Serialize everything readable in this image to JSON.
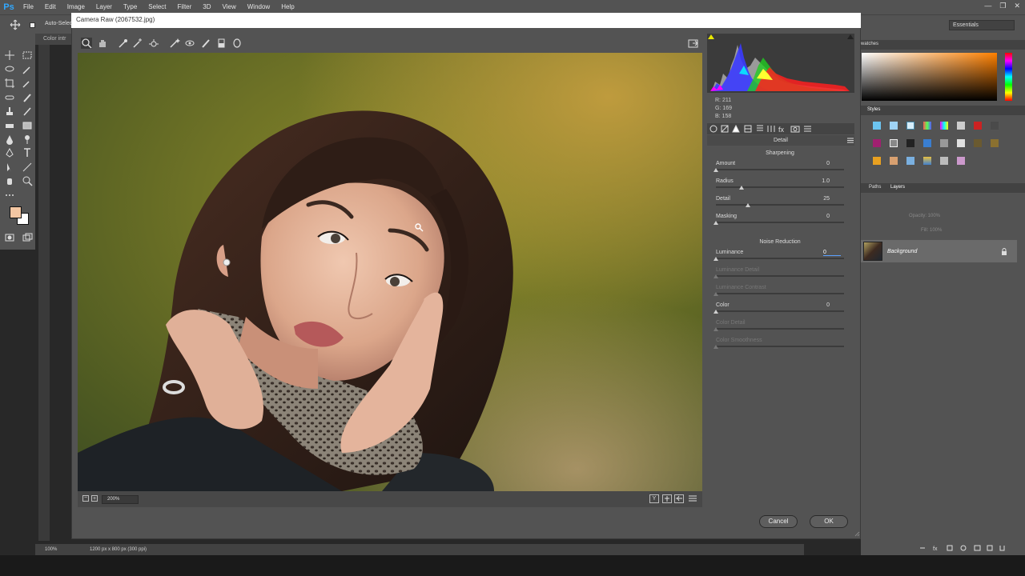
{
  "app": {
    "logo": "Ps"
  },
  "menu": [
    "File",
    "Edit",
    "Image",
    "Layer",
    "Type",
    "Select",
    "Filter",
    "3D",
    "View",
    "Window",
    "Help"
  ],
  "options_bar": {
    "auto_select": "Auto-Select",
    "workspace": "Essentials"
  },
  "document": {
    "tab_partial": "Color intr",
    "ruler_top": "100",
    "zoom": "100%",
    "doc_info": "1200 px x 800 px (300 ppi)"
  },
  "dialog": {
    "title": "Camera Raw (2067532.jpg)",
    "zoom": "200%",
    "rgb": {
      "r": "R:  211",
      "g": "G:  169",
      "b": "B:  158"
    },
    "panel_name": "Detail",
    "sharpening": {
      "title": "Sharpening",
      "sliders": [
        {
          "label": "Amount",
          "value": "0",
          "pos": 0.0
        },
        {
          "label": "Radius",
          "value": "1.0",
          "pos": 0.2
        },
        {
          "label": "Detail",
          "value": "25",
          "pos": 0.25
        },
        {
          "label": "Masking",
          "value": "0",
          "pos": 0.0
        }
      ]
    },
    "noise": {
      "title": "Noise Reduction",
      "sliders": [
        {
          "label": "Luminance",
          "value": "0",
          "pos": 0.0,
          "active": true
        },
        {
          "label": "Luminance Detail",
          "value": "",
          "pos": 0.0,
          "disabled": true
        },
        {
          "label": "Luminance Contrast",
          "value": "",
          "pos": 0.0,
          "disabled": true
        },
        {
          "label": "Color",
          "value": "0",
          "pos": 0.0
        },
        {
          "label": "Color Detail",
          "value": "",
          "pos": 0.0,
          "disabled": true
        },
        {
          "label": "Color Smoothness",
          "value": "",
          "pos": 0.0,
          "disabled": true
        }
      ]
    },
    "cancel": "Cancel",
    "ok": "OK"
  },
  "right_panels": {
    "swatches_tab": "watches",
    "styles_tab": "Styles",
    "paths_tab": "Paths",
    "layers_tab": "Layers",
    "opacity": "Opacity:  100%",
    "fill": "Fill:  100%",
    "layer_name": "Background"
  },
  "colors": {
    "fg": "#f4c7a3",
    "bg": "#ffffff",
    "accent": "#31a8ff"
  }
}
